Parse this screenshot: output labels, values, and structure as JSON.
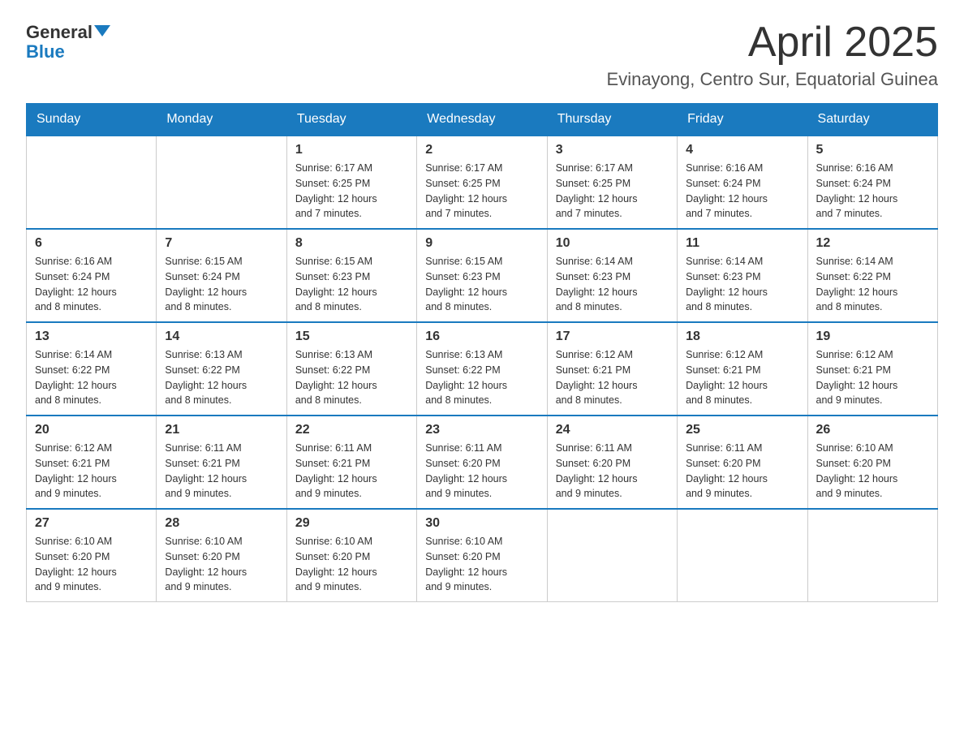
{
  "header": {
    "logo_general": "General",
    "logo_blue": "Blue",
    "month_title": "April 2025",
    "location": "Evinayong, Centro Sur, Equatorial Guinea"
  },
  "days_of_week": [
    "Sunday",
    "Monday",
    "Tuesday",
    "Wednesday",
    "Thursday",
    "Friday",
    "Saturday"
  ],
  "weeks": [
    [
      null,
      null,
      {
        "day": 1,
        "sunrise": "6:17 AM",
        "sunset": "6:25 PM",
        "daylight": "12 hours and 7 minutes."
      },
      {
        "day": 2,
        "sunrise": "6:17 AM",
        "sunset": "6:25 PM",
        "daylight": "12 hours and 7 minutes."
      },
      {
        "day": 3,
        "sunrise": "6:17 AM",
        "sunset": "6:25 PM",
        "daylight": "12 hours and 7 minutes."
      },
      {
        "day": 4,
        "sunrise": "6:16 AM",
        "sunset": "6:24 PM",
        "daylight": "12 hours and 7 minutes."
      },
      {
        "day": 5,
        "sunrise": "6:16 AM",
        "sunset": "6:24 PM",
        "daylight": "12 hours and 7 minutes."
      }
    ],
    [
      {
        "day": 6,
        "sunrise": "6:16 AM",
        "sunset": "6:24 PM",
        "daylight": "12 hours and 8 minutes."
      },
      {
        "day": 7,
        "sunrise": "6:15 AM",
        "sunset": "6:24 PM",
        "daylight": "12 hours and 8 minutes."
      },
      {
        "day": 8,
        "sunrise": "6:15 AM",
        "sunset": "6:23 PM",
        "daylight": "12 hours and 8 minutes."
      },
      {
        "day": 9,
        "sunrise": "6:15 AM",
        "sunset": "6:23 PM",
        "daylight": "12 hours and 8 minutes."
      },
      {
        "day": 10,
        "sunrise": "6:14 AM",
        "sunset": "6:23 PM",
        "daylight": "12 hours and 8 minutes."
      },
      {
        "day": 11,
        "sunrise": "6:14 AM",
        "sunset": "6:23 PM",
        "daylight": "12 hours and 8 minutes."
      },
      {
        "day": 12,
        "sunrise": "6:14 AM",
        "sunset": "6:22 PM",
        "daylight": "12 hours and 8 minutes."
      }
    ],
    [
      {
        "day": 13,
        "sunrise": "6:14 AM",
        "sunset": "6:22 PM",
        "daylight": "12 hours and 8 minutes."
      },
      {
        "day": 14,
        "sunrise": "6:13 AM",
        "sunset": "6:22 PM",
        "daylight": "12 hours and 8 minutes."
      },
      {
        "day": 15,
        "sunrise": "6:13 AM",
        "sunset": "6:22 PM",
        "daylight": "12 hours and 8 minutes."
      },
      {
        "day": 16,
        "sunrise": "6:13 AM",
        "sunset": "6:22 PM",
        "daylight": "12 hours and 8 minutes."
      },
      {
        "day": 17,
        "sunrise": "6:12 AM",
        "sunset": "6:21 PM",
        "daylight": "12 hours and 8 minutes."
      },
      {
        "day": 18,
        "sunrise": "6:12 AM",
        "sunset": "6:21 PM",
        "daylight": "12 hours and 8 minutes."
      },
      {
        "day": 19,
        "sunrise": "6:12 AM",
        "sunset": "6:21 PM",
        "daylight": "12 hours and 9 minutes."
      }
    ],
    [
      {
        "day": 20,
        "sunrise": "6:12 AM",
        "sunset": "6:21 PM",
        "daylight": "12 hours and 9 minutes."
      },
      {
        "day": 21,
        "sunrise": "6:11 AM",
        "sunset": "6:21 PM",
        "daylight": "12 hours and 9 minutes."
      },
      {
        "day": 22,
        "sunrise": "6:11 AM",
        "sunset": "6:21 PM",
        "daylight": "12 hours and 9 minutes."
      },
      {
        "day": 23,
        "sunrise": "6:11 AM",
        "sunset": "6:20 PM",
        "daylight": "12 hours and 9 minutes."
      },
      {
        "day": 24,
        "sunrise": "6:11 AM",
        "sunset": "6:20 PM",
        "daylight": "12 hours and 9 minutes."
      },
      {
        "day": 25,
        "sunrise": "6:11 AM",
        "sunset": "6:20 PM",
        "daylight": "12 hours and 9 minutes."
      },
      {
        "day": 26,
        "sunrise": "6:10 AM",
        "sunset": "6:20 PM",
        "daylight": "12 hours and 9 minutes."
      }
    ],
    [
      {
        "day": 27,
        "sunrise": "6:10 AM",
        "sunset": "6:20 PM",
        "daylight": "12 hours and 9 minutes."
      },
      {
        "day": 28,
        "sunrise": "6:10 AM",
        "sunset": "6:20 PM",
        "daylight": "12 hours and 9 minutes."
      },
      {
        "day": 29,
        "sunrise": "6:10 AM",
        "sunset": "6:20 PM",
        "daylight": "12 hours and 9 minutes."
      },
      {
        "day": 30,
        "sunrise": "6:10 AM",
        "sunset": "6:20 PM",
        "daylight": "12 hours and 9 minutes."
      },
      null,
      null,
      null
    ]
  ]
}
